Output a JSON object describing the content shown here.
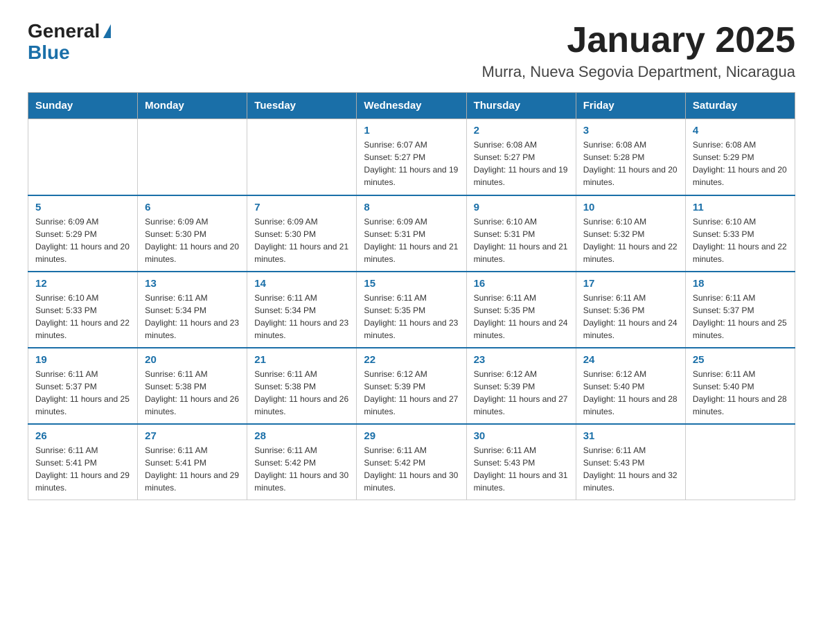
{
  "header": {
    "logo_general": "General",
    "logo_blue": "Blue",
    "month_title": "January 2025",
    "location": "Murra, Nueva Segovia Department, Nicaragua"
  },
  "weekdays": [
    "Sunday",
    "Monday",
    "Tuesday",
    "Wednesday",
    "Thursday",
    "Friday",
    "Saturday"
  ],
  "weeks": [
    [
      {
        "day": "",
        "info": ""
      },
      {
        "day": "",
        "info": ""
      },
      {
        "day": "",
        "info": ""
      },
      {
        "day": "1",
        "info": "Sunrise: 6:07 AM\nSunset: 5:27 PM\nDaylight: 11 hours and 19 minutes."
      },
      {
        "day": "2",
        "info": "Sunrise: 6:08 AM\nSunset: 5:27 PM\nDaylight: 11 hours and 19 minutes."
      },
      {
        "day": "3",
        "info": "Sunrise: 6:08 AM\nSunset: 5:28 PM\nDaylight: 11 hours and 20 minutes."
      },
      {
        "day": "4",
        "info": "Sunrise: 6:08 AM\nSunset: 5:29 PM\nDaylight: 11 hours and 20 minutes."
      }
    ],
    [
      {
        "day": "5",
        "info": "Sunrise: 6:09 AM\nSunset: 5:29 PM\nDaylight: 11 hours and 20 minutes."
      },
      {
        "day": "6",
        "info": "Sunrise: 6:09 AM\nSunset: 5:30 PM\nDaylight: 11 hours and 20 minutes."
      },
      {
        "day": "7",
        "info": "Sunrise: 6:09 AM\nSunset: 5:30 PM\nDaylight: 11 hours and 21 minutes."
      },
      {
        "day": "8",
        "info": "Sunrise: 6:09 AM\nSunset: 5:31 PM\nDaylight: 11 hours and 21 minutes."
      },
      {
        "day": "9",
        "info": "Sunrise: 6:10 AM\nSunset: 5:31 PM\nDaylight: 11 hours and 21 minutes."
      },
      {
        "day": "10",
        "info": "Sunrise: 6:10 AM\nSunset: 5:32 PM\nDaylight: 11 hours and 22 minutes."
      },
      {
        "day": "11",
        "info": "Sunrise: 6:10 AM\nSunset: 5:33 PM\nDaylight: 11 hours and 22 minutes."
      }
    ],
    [
      {
        "day": "12",
        "info": "Sunrise: 6:10 AM\nSunset: 5:33 PM\nDaylight: 11 hours and 22 minutes."
      },
      {
        "day": "13",
        "info": "Sunrise: 6:11 AM\nSunset: 5:34 PM\nDaylight: 11 hours and 23 minutes."
      },
      {
        "day": "14",
        "info": "Sunrise: 6:11 AM\nSunset: 5:34 PM\nDaylight: 11 hours and 23 minutes."
      },
      {
        "day": "15",
        "info": "Sunrise: 6:11 AM\nSunset: 5:35 PM\nDaylight: 11 hours and 23 minutes."
      },
      {
        "day": "16",
        "info": "Sunrise: 6:11 AM\nSunset: 5:35 PM\nDaylight: 11 hours and 24 minutes."
      },
      {
        "day": "17",
        "info": "Sunrise: 6:11 AM\nSunset: 5:36 PM\nDaylight: 11 hours and 24 minutes."
      },
      {
        "day": "18",
        "info": "Sunrise: 6:11 AM\nSunset: 5:37 PM\nDaylight: 11 hours and 25 minutes."
      }
    ],
    [
      {
        "day": "19",
        "info": "Sunrise: 6:11 AM\nSunset: 5:37 PM\nDaylight: 11 hours and 25 minutes."
      },
      {
        "day": "20",
        "info": "Sunrise: 6:11 AM\nSunset: 5:38 PM\nDaylight: 11 hours and 26 minutes."
      },
      {
        "day": "21",
        "info": "Sunrise: 6:11 AM\nSunset: 5:38 PM\nDaylight: 11 hours and 26 minutes."
      },
      {
        "day": "22",
        "info": "Sunrise: 6:12 AM\nSunset: 5:39 PM\nDaylight: 11 hours and 27 minutes."
      },
      {
        "day": "23",
        "info": "Sunrise: 6:12 AM\nSunset: 5:39 PM\nDaylight: 11 hours and 27 minutes."
      },
      {
        "day": "24",
        "info": "Sunrise: 6:12 AM\nSunset: 5:40 PM\nDaylight: 11 hours and 28 minutes."
      },
      {
        "day": "25",
        "info": "Sunrise: 6:11 AM\nSunset: 5:40 PM\nDaylight: 11 hours and 28 minutes."
      }
    ],
    [
      {
        "day": "26",
        "info": "Sunrise: 6:11 AM\nSunset: 5:41 PM\nDaylight: 11 hours and 29 minutes."
      },
      {
        "day": "27",
        "info": "Sunrise: 6:11 AM\nSunset: 5:41 PM\nDaylight: 11 hours and 29 minutes."
      },
      {
        "day": "28",
        "info": "Sunrise: 6:11 AM\nSunset: 5:42 PM\nDaylight: 11 hours and 30 minutes."
      },
      {
        "day": "29",
        "info": "Sunrise: 6:11 AM\nSunset: 5:42 PM\nDaylight: 11 hours and 30 minutes."
      },
      {
        "day": "30",
        "info": "Sunrise: 6:11 AM\nSunset: 5:43 PM\nDaylight: 11 hours and 31 minutes."
      },
      {
        "day": "31",
        "info": "Sunrise: 6:11 AM\nSunset: 5:43 PM\nDaylight: 11 hours and 32 minutes."
      },
      {
        "day": "",
        "info": ""
      }
    ]
  ]
}
